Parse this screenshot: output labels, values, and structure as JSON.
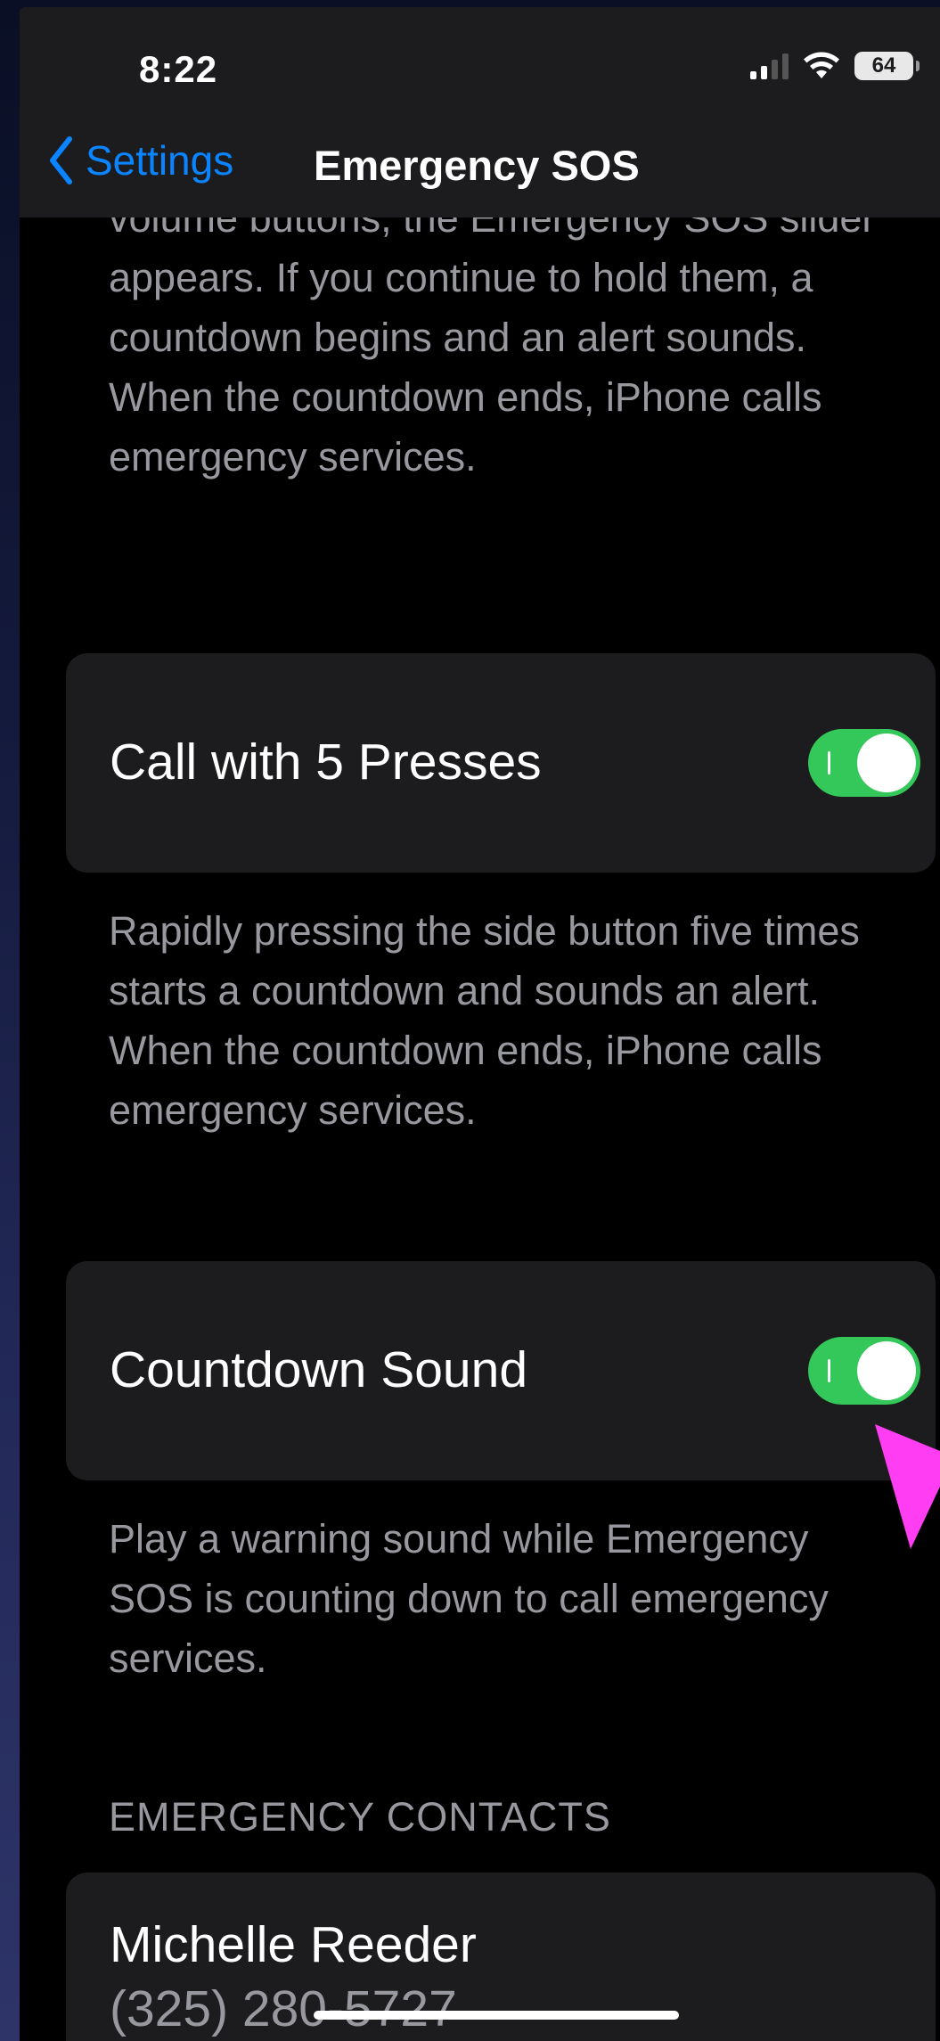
{
  "status_bar": {
    "time": "8:22",
    "battery": "64"
  },
  "nav": {
    "back_label": "Settings",
    "title": "Emergency SOS"
  },
  "intro_text": "volume buttons, the Emergency SOS slider appears. If you continue to hold them, a countdown begins and an alert sounds. When the countdown ends, iPhone calls emergency services.",
  "call_with_5_presses": {
    "label": "Call with 5 Presses",
    "enabled": true,
    "footer": "Rapidly pressing the side button five times starts a countdown and sounds an alert. When the countdown ends, iPhone calls emergency services."
  },
  "countdown_sound": {
    "label": "Countdown Sound",
    "enabled": true,
    "footer": "Play a warning sound while Emergency SOS is counting down to call emergency services."
  },
  "emergency_contacts": {
    "header": "EMERGENCY CONTACTS",
    "contacts": [
      {
        "name": "Michelle Reeder",
        "phone": "(325) 280-5727"
      }
    ]
  },
  "colors": {
    "accent": "#0a84ff",
    "toggle_on": "#34c759",
    "pointer_arrow": "#ff3df2"
  }
}
